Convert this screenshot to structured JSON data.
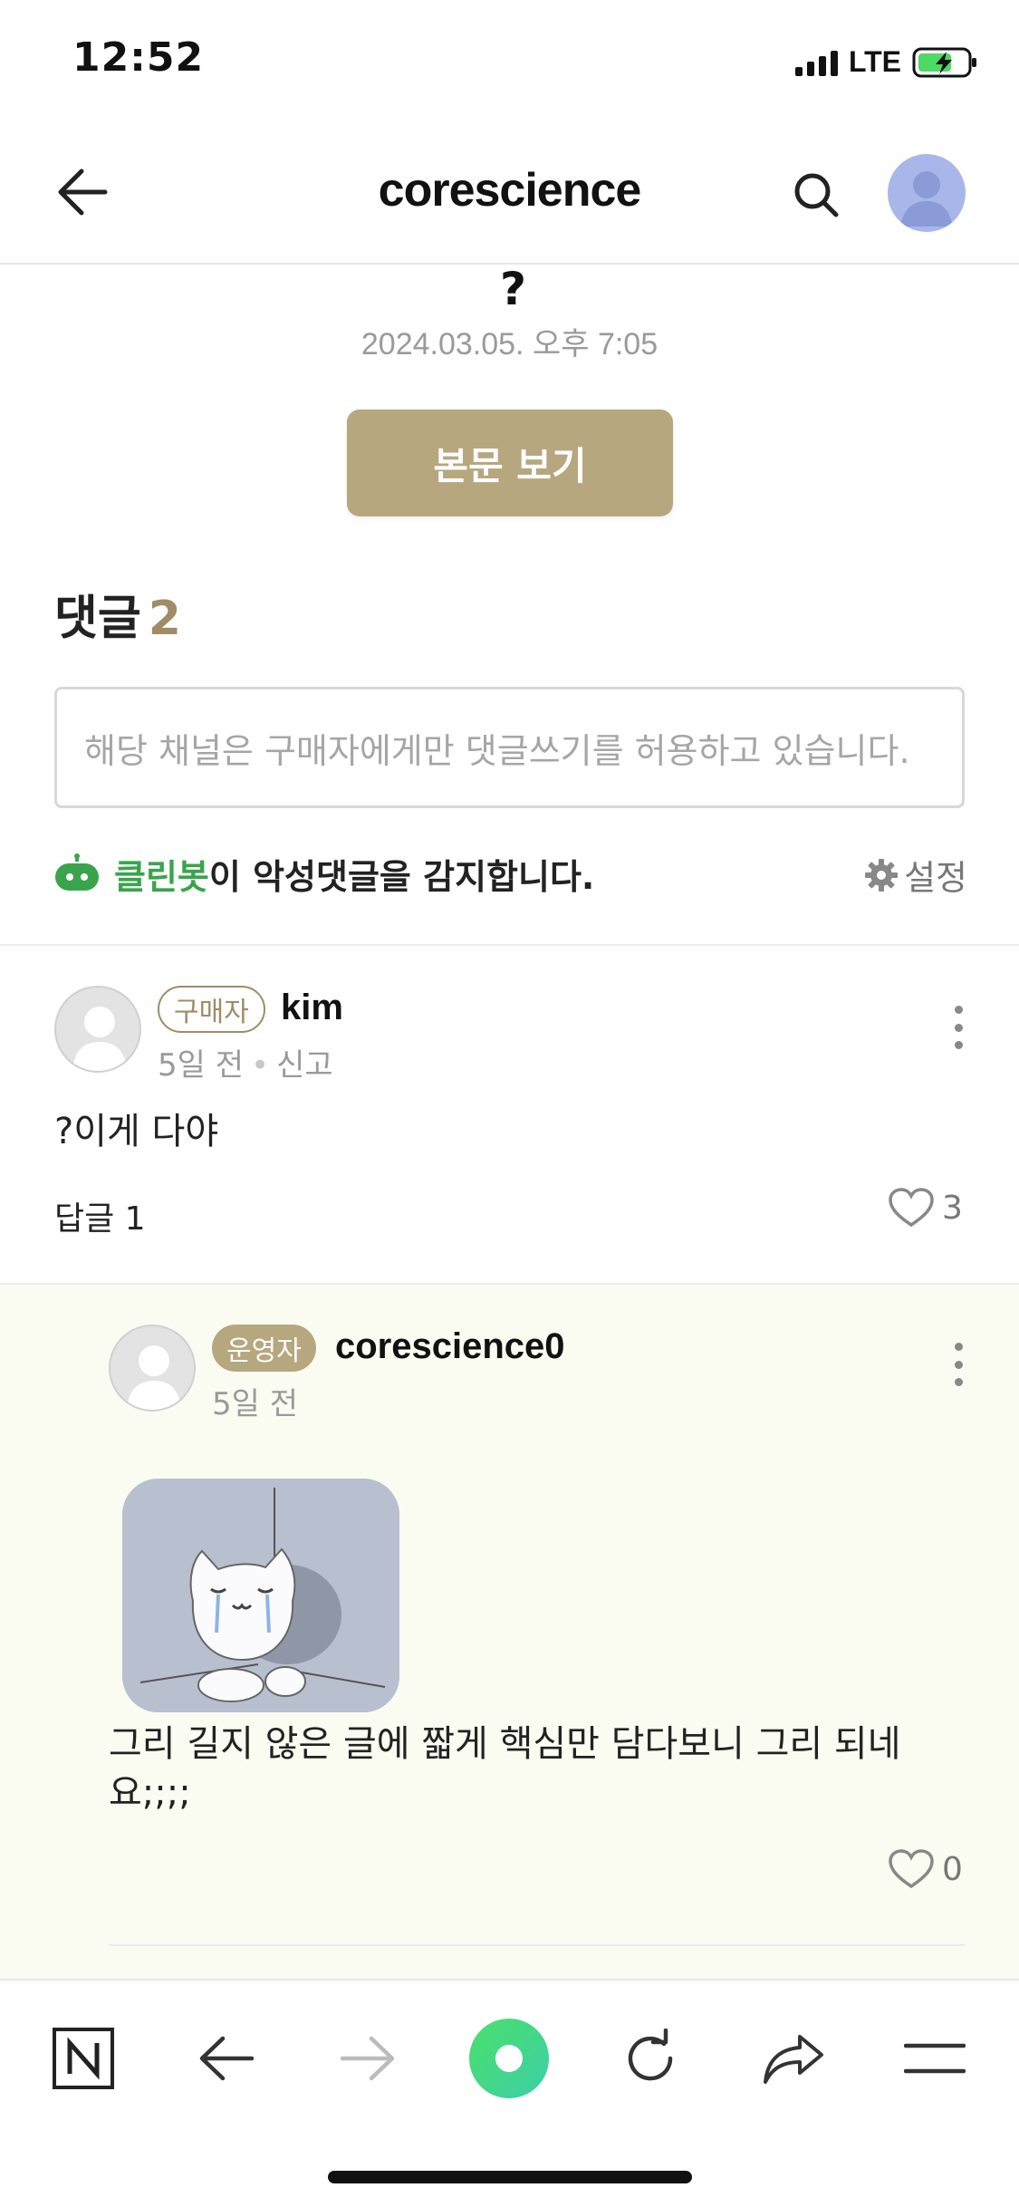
{
  "status_bar": {
    "time": "12:52",
    "network": "LTE",
    "battery_state": "charging"
  },
  "header": {
    "title": "corescience",
    "back_icon": "arrow-left-icon",
    "search_icon": "search-icon",
    "avatar_icon": "user-avatar-icon"
  },
  "post": {
    "title_remnant": "?",
    "date": "2024.03.05. 오후 7:05",
    "view_body_label": "본문 보기"
  },
  "comments": {
    "heading": "댓글",
    "count": "2",
    "input_placeholder": "해당 채널은 구매자에게만 댓글쓰기를 허용하고 있습니다.",
    "cleanbot_name": "클린봇",
    "cleanbot_suffix": "이 악성댓글을 감지합니다.",
    "settings_label": "설정",
    "items": [
      {
        "badge": "구매자",
        "nickname": "kim",
        "time": "5일 전",
        "report_label": "신고",
        "text": "?이게 다야",
        "reply_label": "답글 1",
        "likes": "3"
      }
    ],
    "replies": [
      {
        "badge": "운영자",
        "nickname": "corescience0",
        "time": "5일 전",
        "sticker_icon": "crying-cat-sticker",
        "text_line1": "그리 길지 않은 글에 짧게 핵심만 담다보니 그리 되네",
        "text_line2": "요;;;;",
        "likes": "0"
      }
    ]
  },
  "bottom_nav": {
    "items": [
      "naver-home-icon",
      "back-arrow-icon",
      "forward-arrow-icon",
      "green-dot-icon",
      "refresh-icon",
      "share-icon",
      "menu-icon"
    ]
  },
  "colors": {
    "accent_gold": "#b7a77e",
    "cleanbot_green": "#3aa44d",
    "reply_background": "#fafcf2"
  }
}
